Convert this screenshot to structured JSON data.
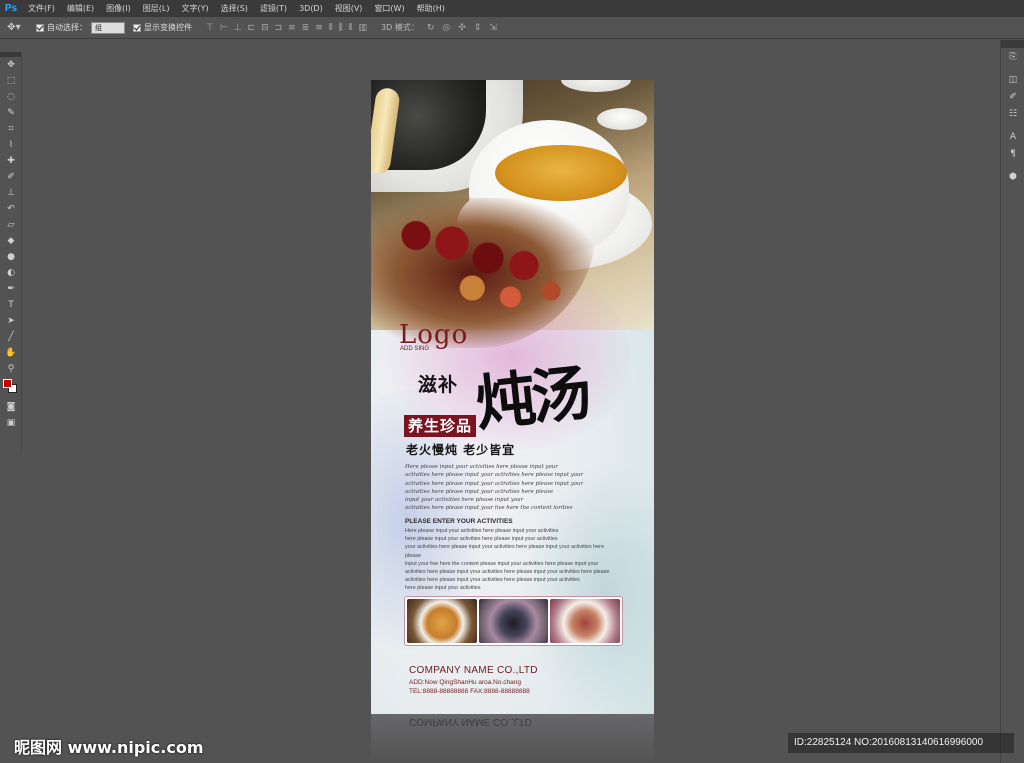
{
  "app": {
    "logo": "Ps"
  },
  "menu": [
    "文件(F)",
    "编辑(E)",
    "图像(I)",
    "图层(L)",
    "文字(Y)",
    "选择(S)",
    "滤镜(T)",
    "3D(D)",
    "视图(V)",
    "窗口(W)",
    "帮助(H)"
  ],
  "options": {
    "auto_select_label": "自动选择：",
    "auto_select_value": "组",
    "show_transform_label": "显示变换控件",
    "mode_3d_label": "3D 模式："
  },
  "poster": {
    "logo": "Logo",
    "logo_sub": "ADD SING",
    "title_small": "滋补",
    "title_big": "炖汤",
    "badge": "养生珍品",
    "subtitle": "老火慢炖  老少皆宜",
    "italic_lines": [
      "Here please input your activities here please input your",
      "activities here please input your activities here please input your",
      "activities here please input your activities here please input your",
      "activities here please input your activities here please",
      "input your activities here please input your",
      "activities here please input your live here the content lorities"
    ],
    "enter_title": "PLEASE ENTER YOUR ACTIVITIES",
    "body_lines": [
      "Here please input your activities here please input your activities",
      "here please input your activities here please input your activities",
      "your activities here please input your activities here please input your activities here please",
      "input your live here the content please input your activities here please input your",
      "activities here please input your activities here please input your activities here please",
      "activities here please input your activities here please input your activities",
      "here please input your activities"
    ],
    "company": "COMPANY NAME CO.,LTD",
    "address": "ADD:Now QingShanHu aroa.No.chang",
    "tel": "TEL:8888-88888888  FAX:8888-88888888",
    "reflection": "COMPANY NAME CO.,LTD"
  },
  "watermark": {
    "left": "昵图网 www.nipic.com",
    "right": "ID:22825124 NO:20160813140616996000"
  },
  "colors": {
    "accent_red": "#7a1420",
    "foreground_swatch": "#c40000",
    "background_swatch": "#ffffff"
  }
}
